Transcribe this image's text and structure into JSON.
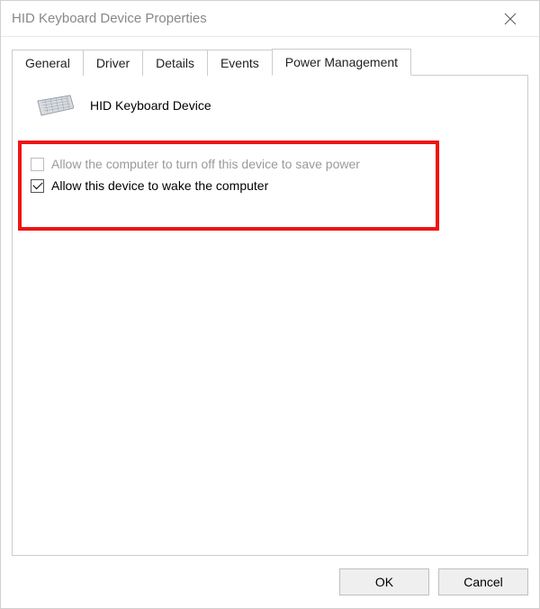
{
  "window": {
    "title": "HID Keyboard Device Properties"
  },
  "tabs": {
    "general": "General",
    "driver": "Driver",
    "details": "Details",
    "events": "Events",
    "power": "Power Management",
    "active": "power"
  },
  "device": {
    "name": "HID Keyboard Device",
    "icon": "keyboard-icon"
  },
  "options": {
    "allow_turn_off": {
      "label": "Allow the computer to turn off this device to save power",
      "checked": false,
      "enabled": false
    },
    "allow_wake": {
      "label": "Allow this device to wake the computer",
      "checked": true,
      "enabled": true
    }
  },
  "buttons": {
    "ok": "OK",
    "cancel": "Cancel"
  }
}
